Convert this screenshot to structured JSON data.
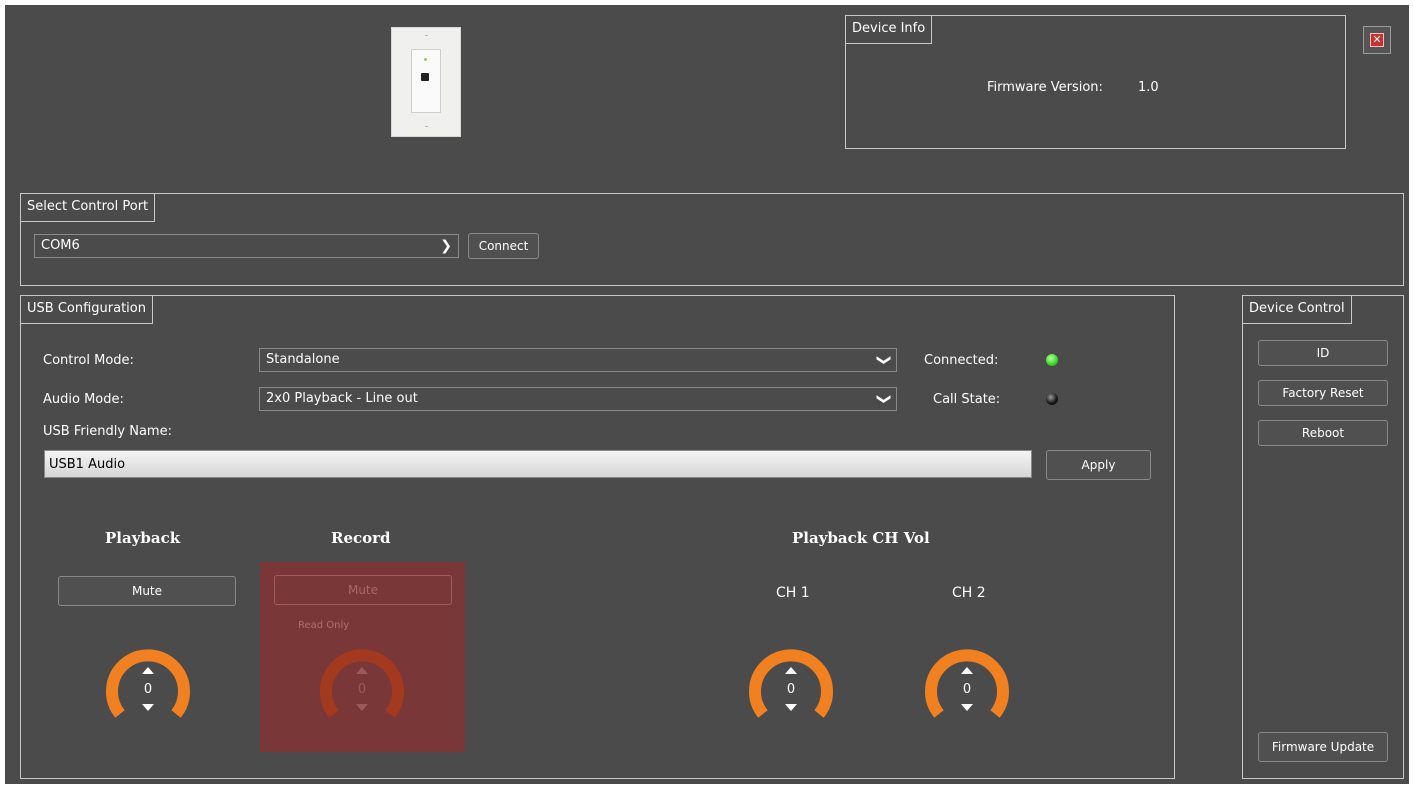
{
  "device_info": {
    "tab": "Device Info",
    "firmware_label": "Firmware Version:",
    "firmware_value": "1.0"
  },
  "close_icon": "close-icon",
  "control_port": {
    "tab": "Select Control Port",
    "selected": "COM6",
    "connect_label": "Connect"
  },
  "usb_config": {
    "tab": "USB Configuration",
    "control_mode_label": "Control Mode:",
    "control_mode_value": "Standalone",
    "audio_mode_label": "Audio Mode:",
    "audio_mode_value": "2x0 Playback - Line out",
    "connected_label": "Connected:",
    "call_state_label": "Call State:",
    "connected_color": "#3fdc2c",
    "call_state_color": "#111111",
    "friendly_name_label": "USB Friendly Name:",
    "friendly_name_value": "USB1 Audio",
    "apply_label": "Apply",
    "playback": {
      "title": "Playback",
      "mute_label": "Mute",
      "value": "0"
    },
    "record": {
      "title": "Record",
      "mute_label": "Mute",
      "readonly_label": "Read Only",
      "value": "0",
      "overlay_color": "#7a3737"
    },
    "playback_ch_vol": {
      "title": "Playback CH Vol",
      "ch1_label": "CH 1",
      "ch1_value": "0",
      "ch2_label": "CH 2",
      "ch2_value": "0"
    },
    "knob_color": "#f08020"
  },
  "device_control": {
    "tab": "Device Control",
    "id_label": "ID",
    "factory_reset_label": "Factory Reset",
    "reboot_label": "Reboot",
    "firmware_update_label": "Firmware Update"
  }
}
